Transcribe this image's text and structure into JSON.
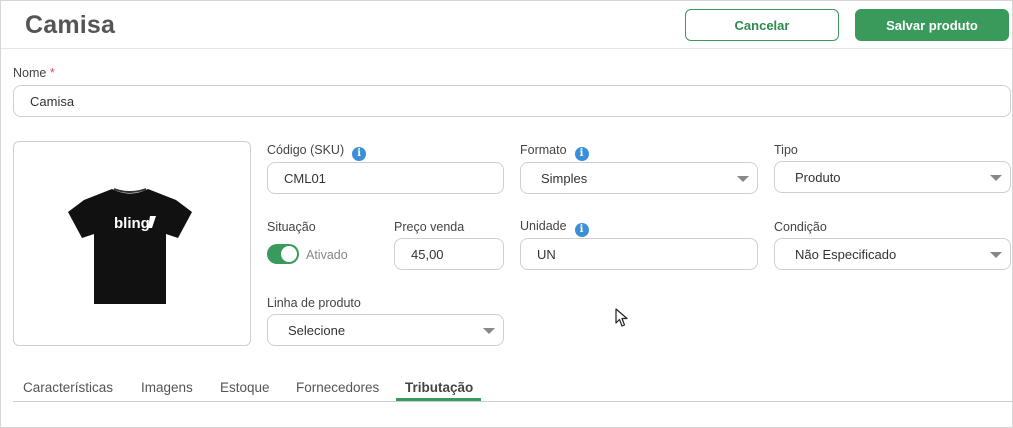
{
  "header": {
    "title": "Camisa",
    "cancel_label": "Cancelar",
    "save_label": "Salvar produto"
  },
  "form": {
    "nome": {
      "label": "Nome",
      "required_mark": "*",
      "value": "Camisa"
    },
    "sku": {
      "label": "Código (SKU)",
      "value": "CML01"
    },
    "formato": {
      "label": "Formato",
      "value": "Simples"
    },
    "tipo": {
      "label": "Tipo",
      "value": "Produto"
    },
    "situacao": {
      "label": "Situação",
      "toggle_label": "Ativado",
      "enabled": true
    },
    "preco": {
      "label": "Preço venda",
      "value": "45,00"
    },
    "unidade": {
      "label": "Unidade",
      "value": "UN"
    },
    "condicao": {
      "label": "Condição",
      "value": "Não Especificado"
    },
    "linha": {
      "label": "Linha de produto",
      "value": "Selecione"
    }
  },
  "product_image": {
    "print_text": "bling"
  },
  "tabs": [
    {
      "label": "Características"
    },
    {
      "label": "Imagens"
    },
    {
      "label": "Estoque"
    },
    {
      "label": "Fornecedores"
    },
    {
      "label": "Tributação",
      "active": true
    }
  ],
  "colors": {
    "accent": "#3a9a5b",
    "info": "#3b8fd8",
    "required": "#d9534f"
  },
  "icons": {
    "info": "info-icon",
    "caret": "chevron-down-icon",
    "cursor": "mouse-pointer-icon"
  }
}
